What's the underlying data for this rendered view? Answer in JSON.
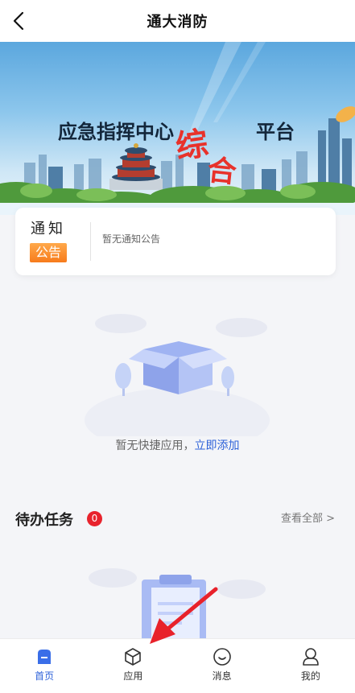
{
  "header": {
    "title": "通大消防",
    "back_icon": "chevron-left-icon"
  },
  "banner": {
    "left_text": "应急指挥中心",
    "accent_char_1": "综",
    "accent_char_2": "合",
    "right_text": "平台",
    "accent_color": "#e8322b"
  },
  "notice": {
    "title": "通知",
    "badge": "公告",
    "text": "暂无通知公告"
  },
  "quick_apps": {
    "empty_text": "暂无快捷应用，",
    "add_link": "立即添加"
  },
  "todo": {
    "title": "待办任务",
    "count": "0",
    "view_all": "查看全部 >"
  },
  "tabbar": {
    "items": [
      {
        "label": "首页",
        "icon": "home-icon",
        "active": true
      },
      {
        "label": "应用",
        "icon": "cube-icon",
        "active": false
      },
      {
        "label": "消息",
        "icon": "message-icon",
        "active": false
      },
      {
        "label": "我的",
        "icon": "user-icon",
        "active": false
      }
    ]
  },
  "colors": {
    "primary": "#2e62d9",
    "badge_red": "#e8232d",
    "notice_orange": "#f77b1c"
  }
}
